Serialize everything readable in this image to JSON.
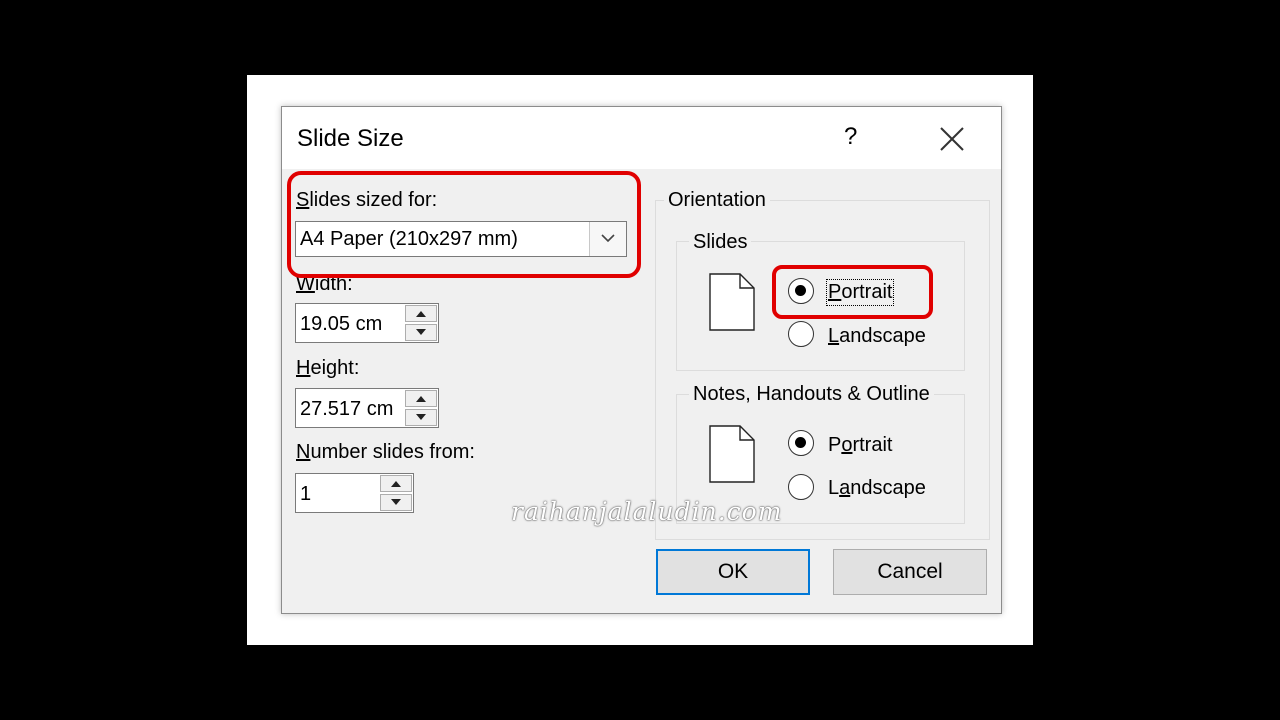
{
  "dialog": {
    "title": "Slide Size",
    "help": "?"
  },
  "left": {
    "slides_sized_for": {
      "underline": "S",
      "rest": "lides sized for:"
    },
    "combo_value": "A4 Paper (210x297 mm)",
    "width": {
      "underline": "W",
      "rest": "idth:",
      "value": "19.05 cm"
    },
    "height": {
      "underline": "H",
      "rest": "eight:",
      "value": "27.517 cm"
    },
    "number": {
      "underline": "N",
      "rest": "umber slides from:",
      "value": "1"
    }
  },
  "orientation": {
    "title": "Orientation",
    "slides": {
      "title": "Slides",
      "portrait": {
        "underline": "P",
        "rest": "ortrait",
        "checked": true
      },
      "landscape": {
        "underline": "L",
        "rest": "andscape",
        "checked": false
      }
    },
    "notes": {
      "title": "Notes, Handouts & Outline",
      "portrait": {
        "pre": "P",
        "underline": "o",
        "rest": "rtrait",
        "checked": true
      },
      "landscape": {
        "pre": "L",
        "underline": "a",
        "rest": "ndscape",
        "checked": false
      }
    }
  },
  "buttons": {
    "ok": "OK",
    "cancel": "Cancel"
  },
  "watermark": "raihanjalaludin.com",
  "colors": {
    "highlight": "#e00000",
    "focus": "#0078d7"
  }
}
